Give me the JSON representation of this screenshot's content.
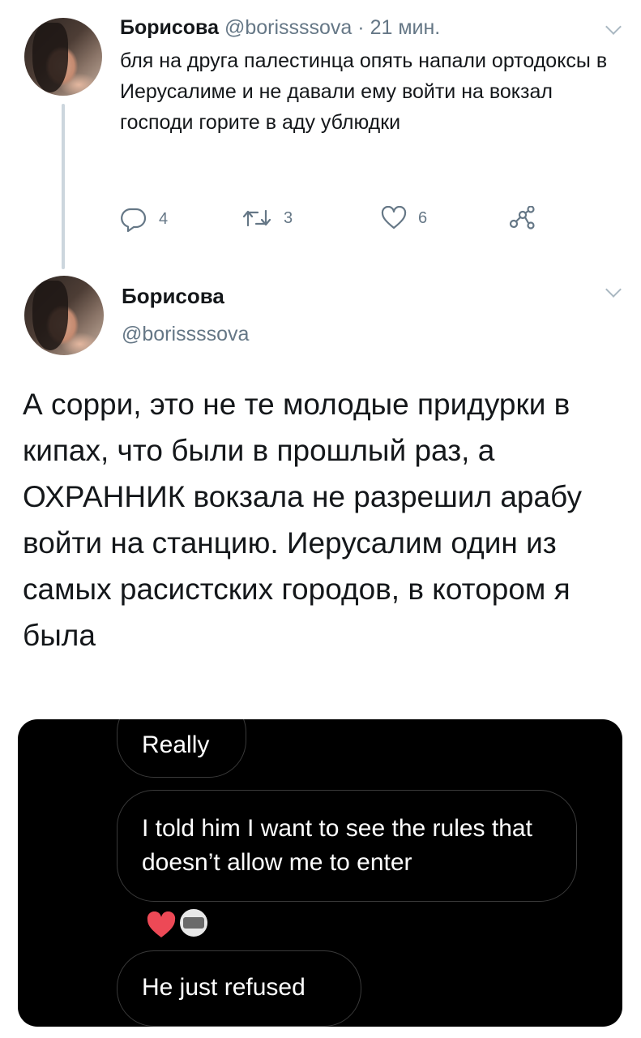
{
  "tweet1": {
    "name": "Борисова",
    "handle": "@borissssova",
    "separator": "·",
    "time": "21 мин.",
    "text": "бля на друга палестинца опять напали ортодоксы в Иерусалиме и не давали ему войти на вокзал господи горите в аду ублюдки",
    "replies": "4",
    "retweets": "3",
    "likes": "6"
  },
  "tweet2": {
    "name": "Борисова",
    "handle": "@borissssova",
    "text": "А сорри, это не те молодые придурки в кипах, что были в прошлый раз, а ОХРАННИК вокзала не разрешил арабу войти на станцию. Иерусалим один из самых расистских городов, в котором я была"
  },
  "media": {
    "messages": [
      {
        "text": "Really"
      },
      {
        "text": "I told him I want to see the rules that doesn’t allow me to enter"
      },
      {
        "text": "He just refused"
      }
    ],
    "reaction_color": "#ed4956"
  },
  "colors": {
    "secondary_text": "#657786",
    "thread_line": "#ccd6dd"
  }
}
